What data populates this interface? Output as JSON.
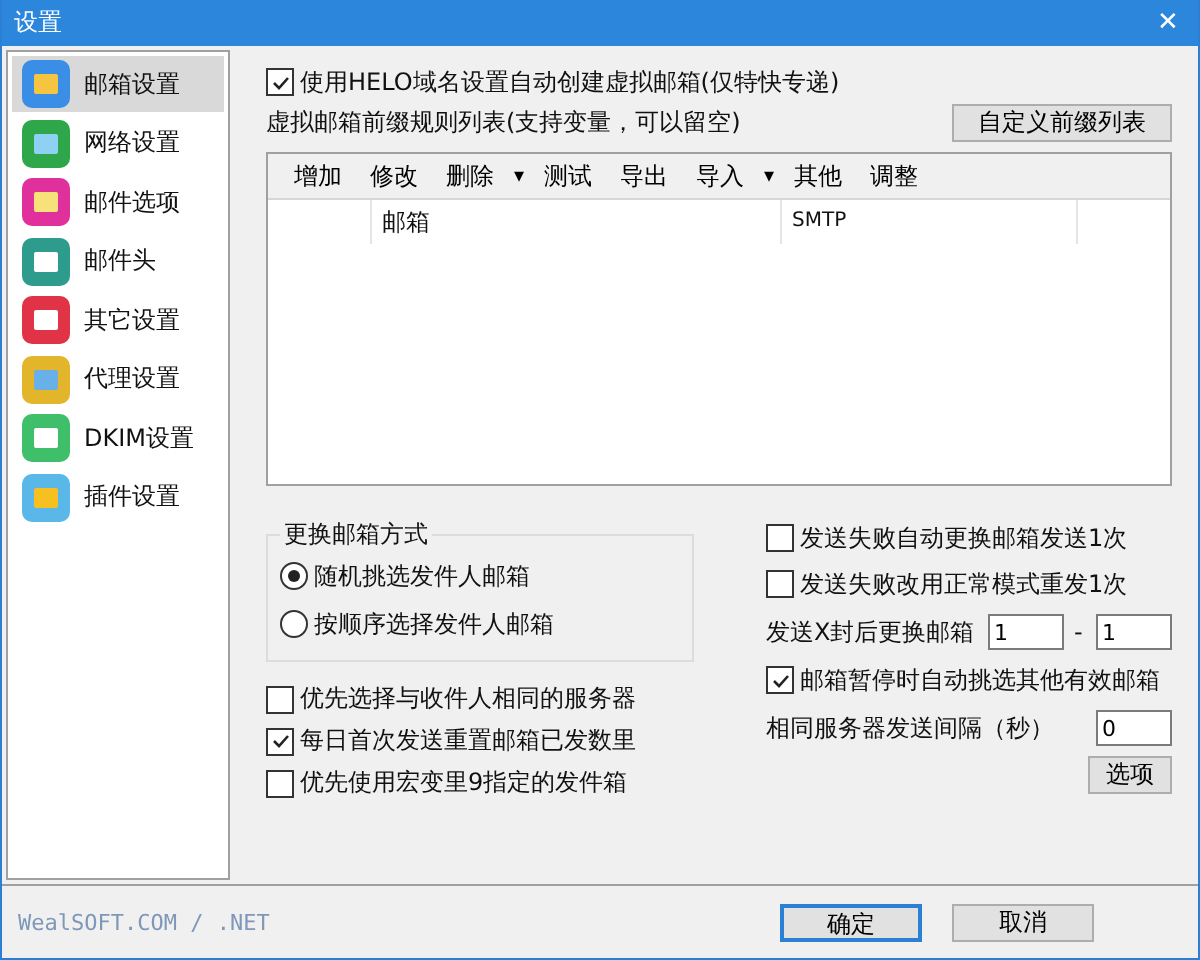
{
  "window": {
    "title": "设置",
    "close": "✕"
  },
  "sidebar": {
    "items": [
      {
        "label": "邮箱设置",
        "selected": true
      },
      {
        "label": "网络设置",
        "selected": false
      },
      {
        "label": "邮件选项",
        "selected": false
      },
      {
        "label": "邮件头",
        "selected": false
      },
      {
        "label": "其它设置",
        "selected": false
      },
      {
        "label": "代理设置",
        "selected": false
      },
      {
        "label": "DKIM设置",
        "selected": false
      },
      {
        "label": "插件设置",
        "selected": false
      }
    ]
  },
  "helo_checkbox": {
    "label": "使用HELO域名设置自动创建虚拟邮箱(仅特快专递)",
    "checked": true
  },
  "prefix_label": "虚拟邮箱前缀规则列表(支持变量，可以留空)",
  "custom_prefix_button": "自定义前缀列表",
  "toolbar": [
    {
      "kind": "button",
      "label": "增加"
    },
    {
      "kind": "button",
      "label": "修改"
    },
    {
      "kind": "button",
      "label": "删除"
    },
    {
      "kind": "dropdown",
      "label": "▾"
    },
    {
      "kind": "button",
      "label": "测试"
    },
    {
      "kind": "button",
      "label": "导出"
    },
    {
      "kind": "button",
      "label": "导入"
    },
    {
      "kind": "dropdown",
      "label": "▾"
    },
    {
      "kind": "button",
      "label": "其他"
    },
    {
      "kind": "button",
      "label": "调整"
    }
  ],
  "table": {
    "columns": [
      "邮箱",
      "SMTP"
    ]
  },
  "switch_group": {
    "title": "更换邮箱方式",
    "options": [
      {
        "label": "随机挑选发件人邮箱",
        "selected": true
      },
      {
        "label": "按顺序选择发件人邮箱",
        "selected": false
      }
    ]
  },
  "left_checks": [
    {
      "label": "优先选择与收件人相同的服务器",
      "checked": false
    },
    {
      "label": "每日首次发送重置邮箱已发数里",
      "checked": true
    },
    {
      "label": "优先使用宏变里9指定的发件箱",
      "checked": false
    }
  ],
  "right_checks": [
    {
      "label": "发送失败自动更换邮箱发送1次",
      "checked": false
    },
    {
      "label": "发送失败改用正常模式重发1次",
      "checked": false
    }
  ],
  "switch_after": {
    "label": "发送X封后更换邮箱",
    "from": "1",
    "separator": "-",
    "to": "1"
  },
  "pause_check": {
    "label": "邮箱暂停时自动挑选其他有效邮箱",
    "checked": true
  },
  "interval": {
    "label": "相同服务器发送间隔（秒）",
    "value": "0"
  },
  "options_button": "选项",
  "footer": {
    "brand": "WealSOFT.COM / .NET",
    "ok": "确定",
    "cancel": "取消"
  }
}
